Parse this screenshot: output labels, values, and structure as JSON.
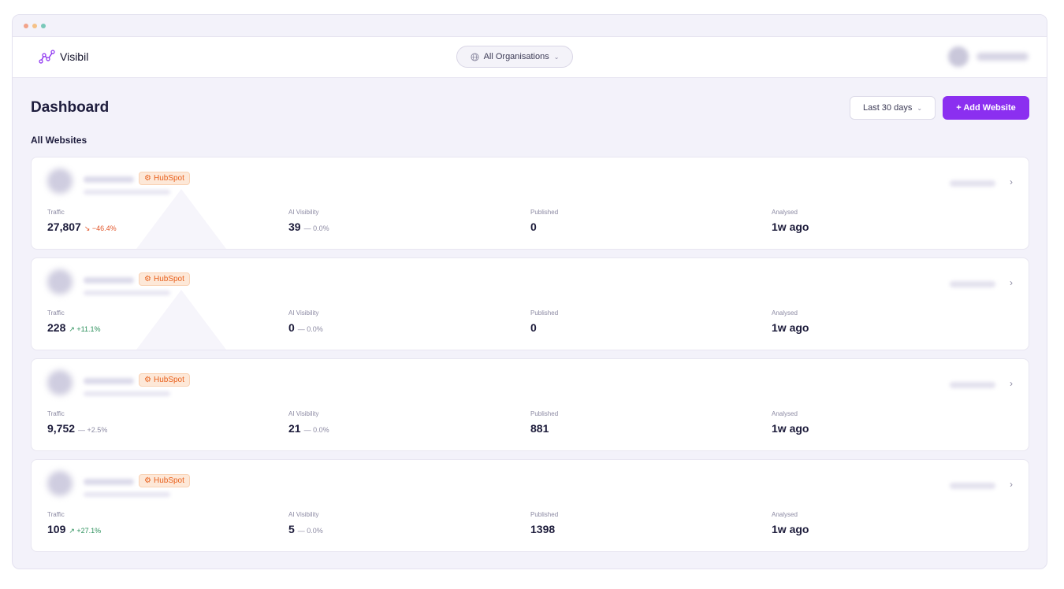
{
  "window": {
    "dots": [
      {
        "name": "close",
        "color": "#f2a389"
      },
      {
        "name": "minimize",
        "color": "#f5c187"
      },
      {
        "name": "maximize",
        "color": "#79c8b9"
      }
    ]
  },
  "topbar": {
    "brand": "Visibil",
    "org_select": "All Organisations"
  },
  "header": {
    "title": "Dashboard",
    "range": "Last 30 days",
    "add_button": "+ Add Website"
  },
  "section": {
    "title": "All Websites"
  },
  "labels": {
    "traffic": "Traffic",
    "ai_visibility": "AI Visibility",
    "published": "Published",
    "analysed": "Analysed"
  },
  "websites": [
    {
      "integration": "HubSpot",
      "traffic": "27,807",
      "traffic_delta": "↘ −46.4%",
      "traffic_trend": "down",
      "ai_visibility": "39",
      "ai_delta": "— 0.0%",
      "published": "0",
      "analysed": "1w ago"
    },
    {
      "integration": "HubSpot",
      "traffic": "228",
      "traffic_delta": "↗ +11.1%",
      "traffic_trend": "up",
      "ai_visibility": "0",
      "ai_delta": "— 0.0%",
      "published": "0",
      "analysed": "1w ago"
    },
    {
      "integration": "HubSpot",
      "traffic": "9,752",
      "traffic_delta": "— +2.5%",
      "traffic_trend": "flat",
      "ai_visibility": "21",
      "ai_delta": "— 0.0%",
      "published": "881",
      "analysed": "1w ago"
    },
    {
      "integration": "HubSpot",
      "traffic": "109",
      "traffic_delta": "↗ +27.1%",
      "traffic_trend": "up",
      "ai_visibility": "5",
      "ai_delta": "— 0.0%",
      "published": "1398",
      "analysed": "1w ago"
    }
  ],
  "colors": {
    "accent": "#8b2ff0",
    "hubspot": "#e8601c",
    "negative": "#e2572b",
    "positive": "#2a8f5a"
  }
}
